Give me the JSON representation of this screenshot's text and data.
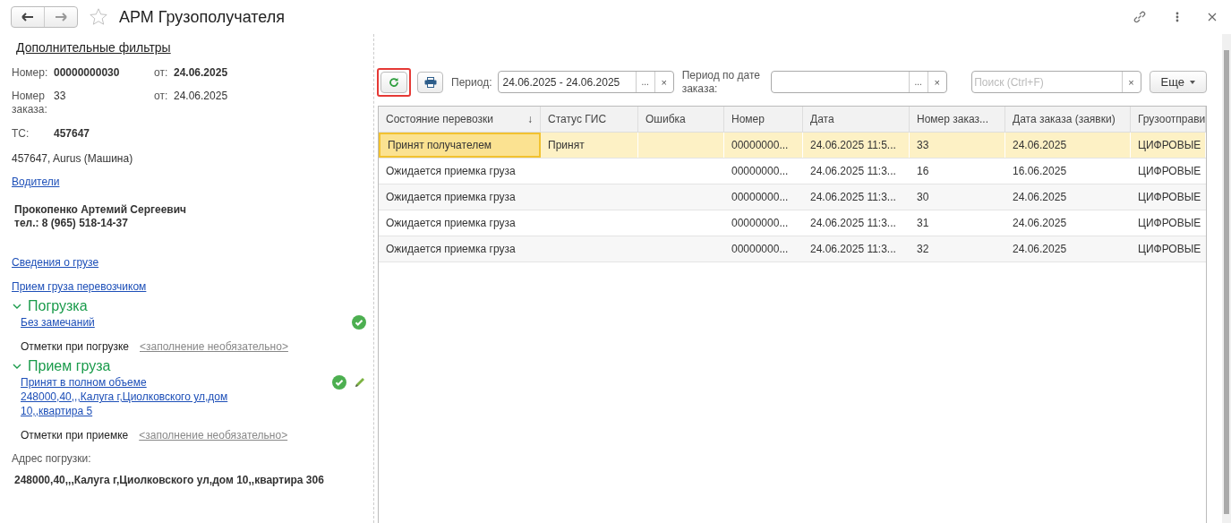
{
  "window": {
    "title": "АРМ Грузополучателя",
    "favorite": false
  },
  "filters_link": "Дополнительные фильтры",
  "document": {
    "number_label": "Номер:",
    "number": "00000000030",
    "date_label": "от:",
    "date": "24.06.2025",
    "order_label": "Номер заказа:",
    "order": "33",
    "order_date_label": "от:",
    "order_date": "24.06.2025",
    "vehicle_label": "ТС:",
    "vehicle": "457647",
    "vehicle_desc": "457647, Aurus (Машина)",
    "drivers_link": "Водители",
    "driver_name": "Прокопенко Артемий Сергеевич",
    "driver_phone": "тел.: 8 (965) 518-14-37",
    "cargo_link": "Сведения о грузе",
    "carrier_link": "Прием груза перевозчиком"
  },
  "sections": [
    {
      "title": "Погрузка",
      "expanded": true,
      "status_link": "Без замечаний",
      "ok": true,
      "editable": false,
      "notes_label": "Отметки при погрузке",
      "notes_placeholder": "<заполнение необязательно>"
    },
    {
      "title": "Прием груза",
      "expanded": true,
      "status_link": "Принят в полном объеме\n248000,40,,,Калуга г,Циолковского ул,дом 10,,квартира 5",
      "ok": true,
      "editable": true,
      "notes_label": "Отметки при приемке",
      "notes_placeholder": "<заполнение необязательно>"
    }
  ],
  "address_label": "Адрес погрузки:",
  "address": "248000,40,,,Калуга г,Циолковского ул,дом 10,,квартира 306",
  "toolbar": {
    "refresh_highlighted": true,
    "period_label": "Период:",
    "period": "24.06.2025 - 24.06.2025",
    "order_period_label": "Период по дате заказа:",
    "search_placeholder": "Поиск (Ctrl+F)",
    "more": "Еще",
    "pick": "...",
    "clear": "×"
  },
  "table": {
    "columns": [
      {
        "label": "Состояние перевозки",
        "sorted": true
      },
      {
        "label": "Статус ГИС",
        "sorted": false
      },
      {
        "label": "Ошибка",
        "sorted": false
      },
      {
        "label": "Номер",
        "sorted": false
      },
      {
        "label": "Дата",
        "sorted": false
      },
      {
        "label": "Номер заказ...",
        "sorted": false
      },
      {
        "label": "Дата заказа (заявки)",
        "sorted": false
      },
      {
        "label": "Грузоотправи",
        "sorted": false
      }
    ],
    "sort_mark": "↓",
    "rows": [
      {
        "selected": true,
        "cells": [
          "Принят получателем",
          "Принят",
          "",
          "00000000...",
          "24.06.2025 11:5...",
          "33",
          "24.06.2025",
          "ЦИФРОВЫЕ"
        ]
      },
      {
        "selected": false,
        "cells": [
          "Ожидается приемка груза",
          "",
          "",
          "00000000...",
          "24.06.2025 11:3...",
          "16",
          "16.06.2025",
          "ЦИФРОВЫЕ"
        ]
      },
      {
        "selected": false,
        "cells": [
          "Ожидается приемка груза",
          "",
          "",
          "00000000...",
          "24.06.2025 11:3...",
          "30",
          "24.06.2025",
          "ЦИФРОВЫЕ"
        ]
      },
      {
        "selected": false,
        "cells": [
          "Ожидается приемка груза",
          "",
          "",
          "00000000...",
          "24.06.2025 11:3...",
          "31",
          "24.06.2025",
          "ЦИФРОВЫЕ"
        ]
      },
      {
        "selected": false,
        "cells": [
          "Ожидается приемка груза",
          "",
          "",
          "00000000...",
          "24.06.2025 11:3...",
          "32",
          "24.06.2025",
          "ЦИФРОВЫЕ"
        ]
      }
    ]
  }
}
